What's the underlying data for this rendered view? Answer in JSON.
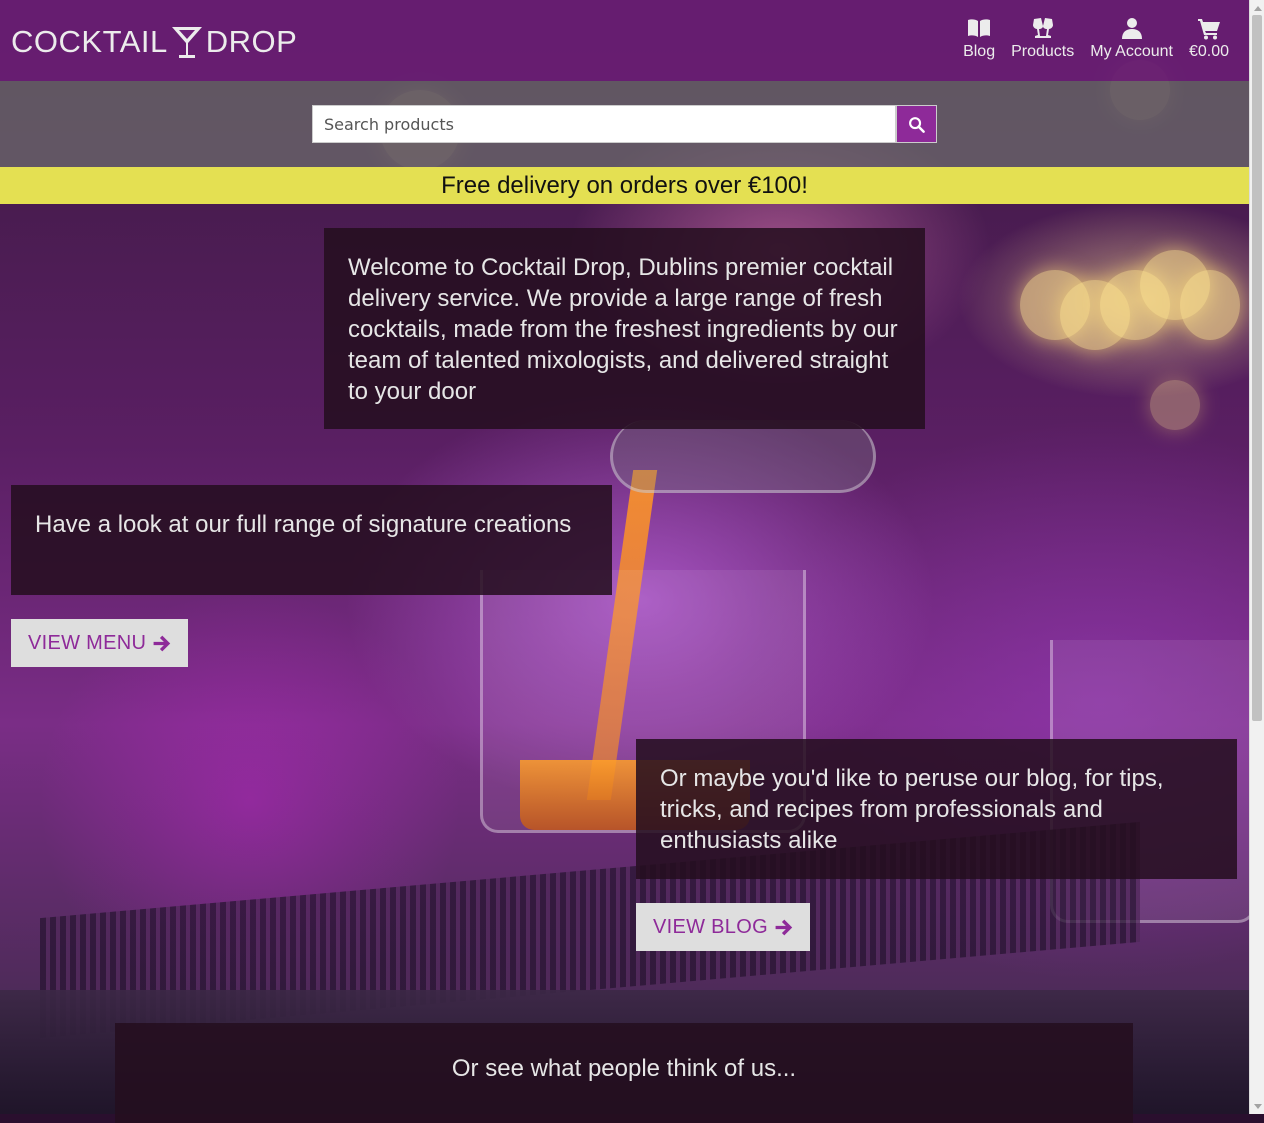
{
  "header": {
    "logo_left": "COCKTAIL",
    "logo_right": "DROP",
    "nav": [
      {
        "label": "Blog",
        "icon": "book-icon"
      },
      {
        "label": "Products",
        "icon": "cocktail-glasses-icon"
      },
      {
        "label": "My Account",
        "icon": "user-icon"
      },
      {
        "label": "€0.00",
        "icon": "cart-icon"
      }
    ]
  },
  "search": {
    "placeholder": "Search products",
    "value": "",
    "button_icon": "search-icon"
  },
  "banner": {
    "text": "Free delivery on orders over €100!"
  },
  "main": {
    "intro": "Welcome to Cocktail Drop, Dublins premier cocktail delivery service. We provide a large range of fresh cocktails, made from the freshest ingredients by our team of talented mixologists, and delivered straight to your door",
    "menu_text": "Have a look at our full range of signature creations",
    "menu_button": "VIEW MENU",
    "blog_text": "Or maybe you'd like to peruse our blog, for tips, tricks, and recipes from professionals and enthusiasts alike",
    "blog_button": "VIEW BLOG",
    "reviews_heading": "Or see what people think of us..."
  },
  "colors": {
    "header_bg": "#6e1e78",
    "accent": "#8e2a99",
    "banner_bg": "#e4e052",
    "button_bg": "#dedede"
  }
}
